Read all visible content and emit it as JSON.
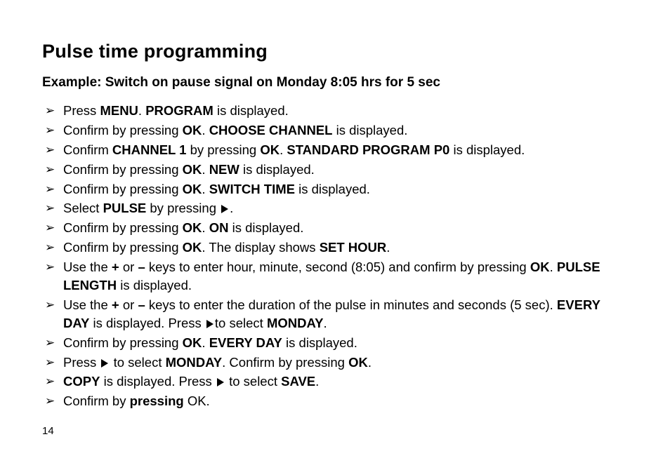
{
  "title": "Pulse time programming",
  "subtitle": "Example: Switch on pause signal on Monday 8:05 hrs for 5 sec",
  "page_number": "14",
  "steps": [
    {
      "segments": [
        {
          "text": "Press "
        },
        {
          "text": "MENU",
          "bold": true
        },
        {
          "text": ". "
        },
        {
          "text": "PROGRAM",
          "bold": true
        },
        {
          "text": " is displayed."
        }
      ]
    },
    {
      "segments": [
        {
          "text": "Confirm by pressing "
        },
        {
          "text": "OK",
          "bold": true
        },
        {
          "text": ". "
        },
        {
          "text": "CHOOSE CHANNEL",
          "bold": true
        },
        {
          "text": " is displayed."
        }
      ]
    },
    {
      "segments": [
        {
          "text": "Confirm "
        },
        {
          "text": "CHANNEL 1",
          "bold": true
        },
        {
          "text": " by pressing "
        },
        {
          "text": "OK",
          "bold": true
        },
        {
          "text": ". "
        },
        {
          "text": "STANDARD PROGRAM P0",
          "bold": true
        },
        {
          "text": " is displayed."
        }
      ]
    },
    {
      "segments": [
        {
          "text": "Confirm by pressing "
        },
        {
          "text": "OK",
          "bold": true
        },
        {
          "text": ". "
        },
        {
          "text": "NEW",
          "bold": true
        },
        {
          "text": " is displayed."
        }
      ]
    },
    {
      "segments": [
        {
          "text": "Confirm by pressing "
        },
        {
          "text": "OK",
          "bold": true
        },
        {
          "text": ". "
        },
        {
          "text": "SWITCH TIME",
          "bold": true
        },
        {
          "text": " is displayed."
        }
      ]
    },
    {
      "segments": [
        {
          "text": "Select "
        },
        {
          "text": "PULSE",
          "bold": true
        },
        {
          "text": " by pressing "
        },
        {
          "triangle": true
        },
        {
          "text": "."
        }
      ]
    },
    {
      "segments": [
        {
          "text": "Confirm by pressing "
        },
        {
          "text": "OK",
          "bold": true
        },
        {
          "text": ". "
        },
        {
          "text": "ON",
          "bold": true
        },
        {
          "text": " is displayed."
        }
      ]
    },
    {
      "segments": [
        {
          "text": "Confirm by pressing "
        },
        {
          "text": "OK",
          "bold": true
        },
        {
          "text": ". The display shows "
        },
        {
          "text": "SET HOUR",
          "bold": true
        },
        {
          "text": "."
        }
      ]
    },
    {
      "segments": [
        {
          "text": "Use the "
        },
        {
          "text": "+",
          "bold": true
        },
        {
          "text": " or "
        },
        {
          "text": "–",
          "bold": true
        },
        {
          "text": " keys to enter hour, minute, second (8:05) and confirm by pressing "
        },
        {
          "text": "OK",
          "bold": true
        },
        {
          "text": ". "
        },
        {
          "text": "PULSE LENGTH",
          "bold": true
        },
        {
          "text": " is displayed."
        }
      ]
    },
    {
      "segments": [
        {
          "text": "Use the "
        },
        {
          "text": "+",
          "bold": true
        },
        {
          "text": " or "
        },
        {
          "text": "–",
          "bold": true
        },
        {
          "text": " keys to enter the duration of the pulse in minutes and seconds (5 sec). "
        },
        {
          "text": "EVERY DAY",
          "bold": true
        },
        {
          "text": " is displayed. Press "
        },
        {
          "triangle": true
        },
        {
          "text": "to select "
        },
        {
          "text": "MONDAY",
          "bold": true
        },
        {
          "text": "."
        }
      ]
    },
    {
      "segments": [
        {
          "text": "Confirm by pressing "
        },
        {
          "text": "OK",
          "bold": true
        },
        {
          "text": ". "
        },
        {
          "text": "EVERY DAY",
          "bold": true
        },
        {
          "text": " is displayed."
        }
      ]
    },
    {
      "segments": [
        {
          "text": "Press "
        },
        {
          "triangle": true
        },
        {
          "text": " to select "
        },
        {
          "text": "MONDAY",
          "bold": true
        },
        {
          "text": ". Confirm by pressing "
        },
        {
          "text": "OK",
          "bold": true
        },
        {
          "text": "."
        }
      ]
    },
    {
      "segments": [
        {
          "text": "COPY",
          "bold": true
        },
        {
          "text": " is displayed. Press "
        },
        {
          "triangle": true
        },
        {
          "text": " to select "
        },
        {
          "text": "SAVE",
          "bold": true
        },
        {
          "text": "."
        }
      ]
    },
    {
      "segments": [
        {
          "text": "Confirm by "
        },
        {
          "text": "pressing",
          "bold": true
        },
        {
          "text": " OK."
        }
      ]
    }
  ]
}
